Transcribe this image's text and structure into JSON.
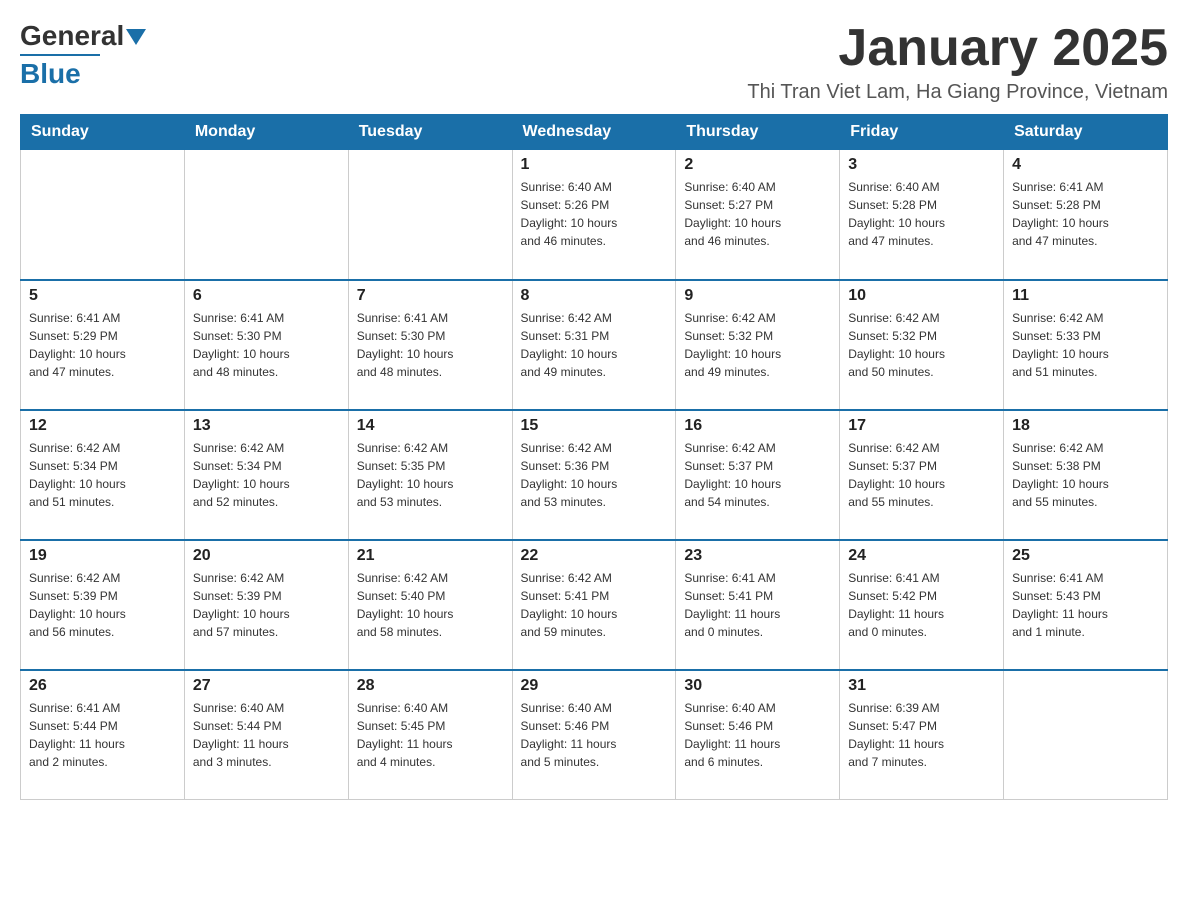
{
  "header": {
    "logo_general": "General",
    "logo_blue": "Blue",
    "month_title": "January 2025",
    "location": "Thi Tran Viet Lam, Ha Giang Province, Vietnam"
  },
  "weekdays": [
    "Sunday",
    "Monday",
    "Tuesday",
    "Wednesday",
    "Thursday",
    "Friday",
    "Saturday"
  ],
  "weeks": [
    [
      {
        "day": "",
        "info": ""
      },
      {
        "day": "",
        "info": ""
      },
      {
        "day": "",
        "info": ""
      },
      {
        "day": "1",
        "info": "Sunrise: 6:40 AM\nSunset: 5:26 PM\nDaylight: 10 hours\nand 46 minutes."
      },
      {
        "day": "2",
        "info": "Sunrise: 6:40 AM\nSunset: 5:27 PM\nDaylight: 10 hours\nand 46 minutes."
      },
      {
        "day": "3",
        "info": "Sunrise: 6:40 AM\nSunset: 5:28 PM\nDaylight: 10 hours\nand 47 minutes."
      },
      {
        "day": "4",
        "info": "Sunrise: 6:41 AM\nSunset: 5:28 PM\nDaylight: 10 hours\nand 47 minutes."
      }
    ],
    [
      {
        "day": "5",
        "info": "Sunrise: 6:41 AM\nSunset: 5:29 PM\nDaylight: 10 hours\nand 47 minutes."
      },
      {
        "day": "6",
        "info": "Sunrise: 6:41 AM\nSunset: 5:30 PM\nDaylight: 10 hours\nand 48 minutes."
      },
      {
        "day": "7",
        "info": "Sunrise: 6:41 AM\nSunset: 5:30 PM\nDaylight: 10 hours\nand 48 minutes."
      },
      {
        "day": "8",
        "info": "Sunrise: 6:42 AM\nSunset: 5:31 PM\nDaylight: 10 hours\nand 49 minutes."
      },
      {
        "day": "9",
        "info": "Sunrise: 6:42 AM\nSunset: 5:32 PM\nDaylight: 10 hours\nand 49 minutes."
      },
      {
        "day": "10",
        "info": "Sunrise: 6:42 AM\nSunset: 5:32 PM\nDaylight: 10 hours\nand 50 minutes."
      },
      {
        "day": "11",
        "info": "Sunrise: 6:42 AM\nSunset: 5:33 PM\nDaylight: 10 hours\nand 51 minutes."
      }
    ],
    [
      {
        "day": "12",
        "info": "Sunrise: 6:42 AM\nSunset: 5:34 PM\nDaylight: 10 hours\nand 51 minutes."
      },
      {
        "day": "13",
        "info": "Sunrise: 6:42 AM\nSunset: 5:34 PM\nDaylight: 10 hours\nand 52 minutes."
      },
      {
        "day": "14",
        "info": "Sunrise: 6:42 AM\nSunset: 5:35 PM\nDaylight: 10 hours\nand 53 minutes."
      },
      {
        "day": "15",
        "info": "Sunrise: 6:42 AM\nSunset: 5:36 PM\nDaylight: 10 hours\nand 53 minutes."
      },
      {
        "day": "16",
        "info": "Sunrise: 6:42 AM\nSunset: 5:37 PM\nDaylight: 10 hours\nand 54 minutes."
      },
      {
        "day": "17",
        "info": "Sunrise: 6:42 AM\nSunset: 5:37 PM\nDaylight: 10 hours\nand 55 minutes."
      },
      {
        "day": "18",
        "info": "Sunrise: 6:42 AM\nSunset: 5:38 PM\nDaylight: 10 hours\nand 55 minutes."
      }
    ],
    [
      {
        "day": "19",
        "info": "Sunrise: 6:42 AM\nSunset: 5:39 PM\nDaylight: 10 hours\nand 56 minutes."
      },
      {
        "day": "20",
        "info": "Sunrise: 6:42 AM\nSunset: 5:39 PM\nDaylight: 10 hours\nand 57 minutes."
      },
      {
        "day": "21",
        "info": "Sunrise: 6:42 AM\nSunset: 5:40 PM\nDaylight: 10 hours\nand 58 minutes."
      },
      {
        "day": "22",
        "info": "Sunrise: 6:42 AM\nSunset: 5:41 PM\nDaylight: 10 hours\nand 59 minutes."
      },
      {
        "day": "23",
        "info": "Sunrise: 6:41 AM\nSunset: 5:41 PM\nDaylight: 11 hours\nand 0 minutes."
      },
      {
        "day": "24",
        "info": "Sunrise: 6:41 AM\nSunset: 5:42 PM\nDaylight: 11 hours\nand 0 minutes."
      },
      {
        "day": "25",
        "info": "Sunrise: 6:41 AM\nSunset: 5:43 PM\nDaylight: 11 hours\nand 1 minute."
      }
    ],
    [
      {
        "day": "26",
        "info": "Sunrise: 6:41 AM\nSunset: 5:44 PM\nDaylight: 11 hours\nand 2 minutes."
      },
      {
        "day": "27",
        "info": "Sunrise: 6:40 AM\nSunset: 5:44 PM\nDaylight: 11 hours\nand 3 minutes."
      },
      {
        "day": "28",
        "info": "Sunrise: 6:40 AM\nSunset: 5:45 PM\nDaylight: 11 hours\nand 4 minutes."
      },
      {
        "day": "29",
        "info": "Sunrise: 6:40 AM\nSunset: 5:46 PM\nDaylight: 11 hours\nand 5 minutes."
      },
      {
        "day": "30",
        "info": "Sunrise: 6:40 AM\nSunset: 5:46 PM\nDaylight: 11 hours\nand 6 minutes."
      },
      {
        "day": "31",
        "info": "Sunrise: 6:39 AM\nSunset: 5:47 PM\nDaylight: 11 hours\nand 7 minutes."
      },
      {
        "day": "",
        "info": ""
      }
    ]
  ]
}
